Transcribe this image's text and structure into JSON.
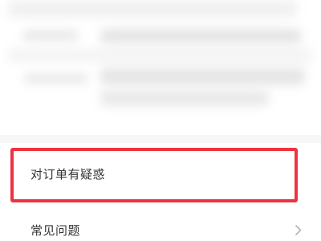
{
  "menu": {
    "question_order_label": "对订单有疑惑",
    "faq_label": "常见问题"
  },
  "annotation": {
    "highlight_color": "#ee3340"
  },
  "icons": {
    "faq_chevron": "chevron-right-icon"
  }
}
